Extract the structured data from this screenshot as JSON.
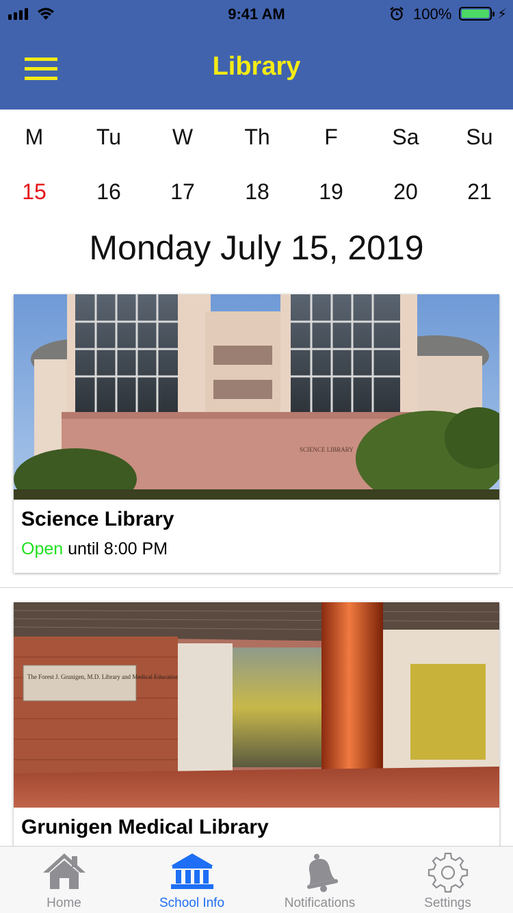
{
  "status_bar": {
    "time": "9:41 AM",
    "battery_percent": "100%",
    "battery_level": 1.0
  },
  "header": {
    "title": "Library",
    "menu_icon": "hamburger-menu-icon"
  },
  "week": {
    "days": [
      {
        "name": "M",
        "date": "15",
        "today": true
      },
      {
        "name": "Tu",
        "date": "16",
        "today": false
      },
      {
        "name": "W",
        "date": "17",
        "today": false
      },
      {
        "name": "Th",
        "date": "18",
        "today": false
      },
      {
        "name": "F",
        "date": "19",
        "today": false
      },
      {
        "name": "Sa",
        "date": "20",
        "today": false
      },
      {
        "name": "Su",
        "date": "21",
        "today": false
      }
    ]
  },
  "selected_date": "Monday July 15, 2019",
  "libraries": [
    {
      "name": "Science Library",
      "status": "Open",
      "hours": "until 8:00 PM",
      "photo_sign_text": "SCIENCE LIBRARY"
    },
    {
      "name": "Grunigen Medical Library",
      "photo_sign_text": "The Forest J. Grunigen, M.D. Library and Medical Education Center"
    }
  ],
  "tabs": [
    {
      "label": "Home",
      "icon": "home-icon",
      "active": false
    },
    {
      "label": "School Info",
      "icon": "school-building-icon",
      "active": true
    },
    {
      "label": "Notifications",
      "icon": "bell-icon",
      "active": false
    },
    {
      "label": "Settings",
      "icon": "gear-icon",
      "active": false
    }
  ],
  "colors": {
    "header_bg": "#4163ae",
    "header_accent": "#f4eb16",
    "today": "#e5141a",
    "open": "#21e021",
    "tab_active": "#1e6ff5",
    "tab_inactive": "#8e8e93"
  }
}
